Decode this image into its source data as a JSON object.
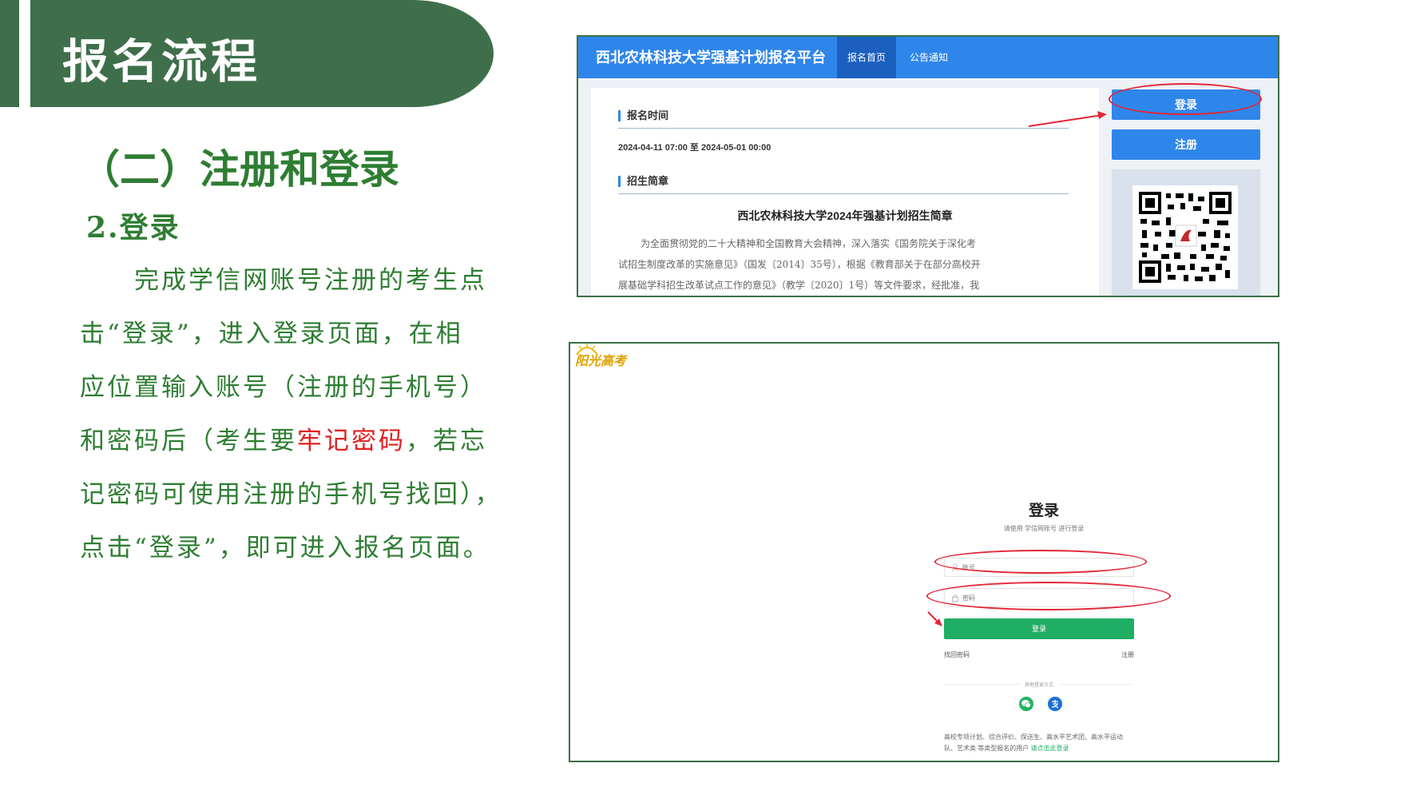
{
  "header": {
    "title": "报名流程"
  },
  "section": {
    "title": "（二）注册和登录",
    "subtitle": "2.登录",
    "lines": [
      "完成学信网账号注册的考生点",
      "击“登录”，进入登录页面，在相",
      "应位置输入账号（注册的手机号）"
    ],
    "line4_pre": "和密码后（考生要",
    "line4_red": "牢记密码",
    "line4_post": "，若忘",
    "line5": "记密码可使用注册的手机号找回），",
    "line6": "点击“登录”，即可进入报名页面。"
  },
  "portal": {
    "title": "西北农林科技大学强基计划报名平台",
    "tabs": [
      "报名首页",
      "公告通知"
    ],
    "time_label": "报名时间",
    "time_value": "2024-04-11 07:00 至 2024-05-01 00:00",
    "brochure_label": "招生简章",
    "article_title": "西北农林科技大学2024年强基计划招生简章",
    "article_lines": [
      "为全面贯彻党的二十大精神和全国教育大会精神，深入落实《国务院关于深化考",
      "试招生制度改革的实施意见》（国发〔2014〕35号），根据《教育部关于在部分高校开",
      "展基础学科招生改革试点工作的意见》（教学〔2020〕1号）等文件要求，经批准，我"
    ],
    "login_button": "登录",
    "register_button": "注册"
  },
  "login": {
    "logo": "阳光高考",
    "title": "登录",
    "hint": "请使用 学信网账号 进行登录",
    "account_placeholder": "账号",
    "password_placeholder": "密码",
    "submit": "登录",
    "forgot": "找回密码",
    "register": "注册",
    "other_methods": "其他登录方式",
    "notice_line1": "高校专项计划、综合评价、保送生、高水平艺术团、高水平运动",
    "notice_line2_pre": "队、艺术类 等类型报名的用户 ",
    "notice_link": "请点击此登录"
  },
  "colors": {
    "banner": "#3f6f4a",
    "heading": "#2e7d32",
    "highlight": "#e02020",
    "portal_blue": "#2f86ea",
    "login_green": "#1fae63",
    "annotation": "#e32636"
  }
}
